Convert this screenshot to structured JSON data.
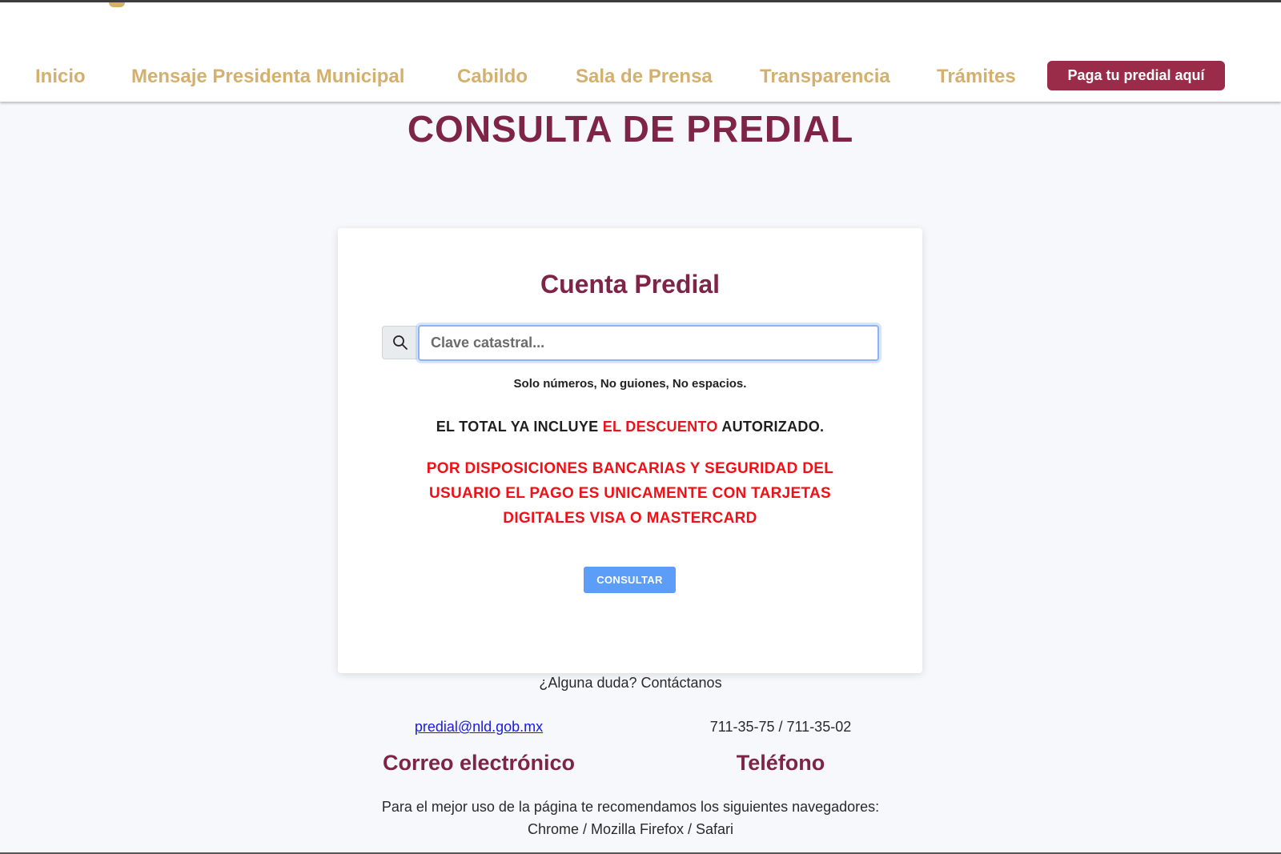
{
  "nav": {
    "items": [
      {
        "label": "Inicio"
      },
      {
        "label": "Mensaje Presidenta Municipal"
      },
      {
        "label": "Cabildo"
      },
      {
        "label": "Sala de Prensa"
      },
      {
        "label": "Transparencia"
      },
      {
        "label": "Trámites"
      }
    ],
    "cta_label": "Paga tu predial aquí"
  },
  "page_title": "CONSULTA DE PREDIAL",
  "card": {
    "title": "Cuenta Predial",
    "search_icon": "search-icon",
    "input_placeholder": "Clave catastral...",
    "input_value": "",
    "hint": "Solo números, No guiones, No espacios.",
    "notice_part1": "EL TOTAL YA INCLUYE ",
    "notice_highlight": "EL DESCUENTO",
    "notice_part2": " AUTORIZADO.",
    "warning": "POR DISPOSICIONES BANCARIAS Y SEGURIDAD DEL USUARIO EL PAGO ES UNICAMENTE CON TARJETAS DIGITALES VISA O MASTERCARD",
    "button_label": "CONSULTAR"
  },
  "contact": {
    "question": "¿Alguna duda? Contáctanos",
    "email": "predial@nld.gob.mx",
    "phone": "711-35-75 / 711-35-02",
    "email_label": "Correo electrónico",
    "phone_label": "Teléfono"
  },
  "browsers": {
    "line1": "Para el mejor uso de la página te recomendamos los siguientes navegadores:",
    "line2": "Chrome / Mozilla Firefox / Safari"
  },
  "colors": {
    "brand_maroon": "#7e2447",
    "nav_gold": "#d4b06e",
    "cta_bg": "#9b2c49",
    "button_blue": "#5c9df7",
    "warning_red": "#ef1118"
  }
}
